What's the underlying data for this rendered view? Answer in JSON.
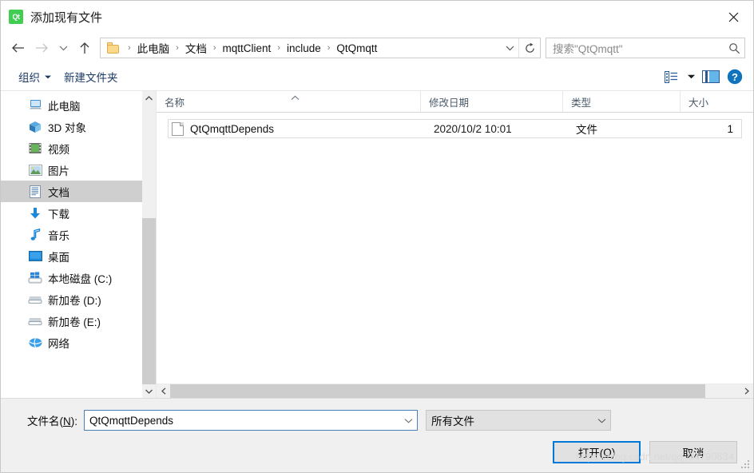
{
  "window": {
    "title": "添加现有文件",
    "app_icon_text": "Qt",
    "app_icon_color": "#41cd52",
    "close_label": "✕"
  },
  "nav": {
    "back_icon": "arrow-left-icon",
    "forward_icon": "arrow-right-icon",
    "recent_icon": "chevron-down-icon",
    "up_icon": "arrow-up-icon",
    "breadcrumbs": [
      "此电脑",
      "文档",
      "mqttClient",
      "include",
      "QtQmqtt"
    ],
    "separator": "›",
    "refresh_icon": "refresh-icon",
    "dropdown_icon": "chevron-down-icon"
  },
  "search": {
    "placeholder": "搜索\"QtQmqtt\"",
    "icon": "search-icon"
  },
  "toolbar": {
    "organize_label": "组织",
    "new_folder_label": "新建文件夹",
    "view_icon": "list-view-icon",
    "view_caret": "chevron-down-icon",
    "preview_icon": "preview-pane-icon",
    "help_icon": "help-icon",
    "help_glyph": "?"
  },
  "sidebar": {
    "items": [
      {
        "label": "此电脑",
        "icon": "computer-icon",
        "selected": false
      },
      {
        "label": "3D 对象",
        "icon": "3d-objects-icon",
        "selected": false
      },
      {
        "label": "视频",
        "icon": "videos-icon",
        "selected": false
      },
      {
        "label": "图片",
        "icon": "pictures-icon",
        "selected": false
      },
      {
        "label": "文档",
        "icon": "documents-icon",
        "selected": true
      },
      {
        "label": "下载",
        "icon": "downloads-icon",
        "selected": false
      },
      {
        "label": "音乐",
        "icon": "music-icon",
        "selected": false
      },
      {
        "label": "桌面",
        "icon": "desktop-icon",
        "selected": false
      },
      {
        "label": "本地磁盘 (C:)",
        "icon": "windows-drive-icon",
        "selected": false
      },
      {
        "label": "新加卷 (D:)",
        "icon": "drive-icon",
        "selected": false
      },
      {
        "label": "新加卷 (E:)",
        "icon": "drive-icon",
        "selected": false
      },
      {
        "label": "网络",
        "icon": "network-icon",
        "selected": false
      }
    ],
    "scroll_up_icon": "chevron-up-icon",
    "scroll_down_icon": "chevron-down-icon"
  },
  "filelist": {
    "columns": [
      {
        "label": "名称",
        "sorted": "asc"
      },
      {
        "label": "修改日期",
        "sorted": ""
      },
      {
        "label": "类型",
        "sorted": ""
      },
      {
        "label": "大小",
        "sorted": ""
      }
    ],
    "rows": [
      {
        "name": "QtQmqttDepends",
        "date": "2020/10/2 10:01",
        "type": "文件",
        "size": "1",
        "icon": "generic-file-icon",
        "selected": true
      }
    ],
    "hscroll_left_icon": "chevron-left-icon",
    "hscroll_right_icon": "chevron-right-icon"
  },
  "footer": {
    "filename_label_pre": "文件名(",
    "filename_label_key": "N",
    "filename_label_post": "):",
    "filename_value": "QtQmqttDepends",
    "filter_value": "所有文件",
    "open_label_pre": "打开(",
    "open_label_key": "O",
    "open_label_post": ")",
    "cancel_label": "取消",
    "watermark": "https://blog.csdn.net/qq_34790634"
  }
}
